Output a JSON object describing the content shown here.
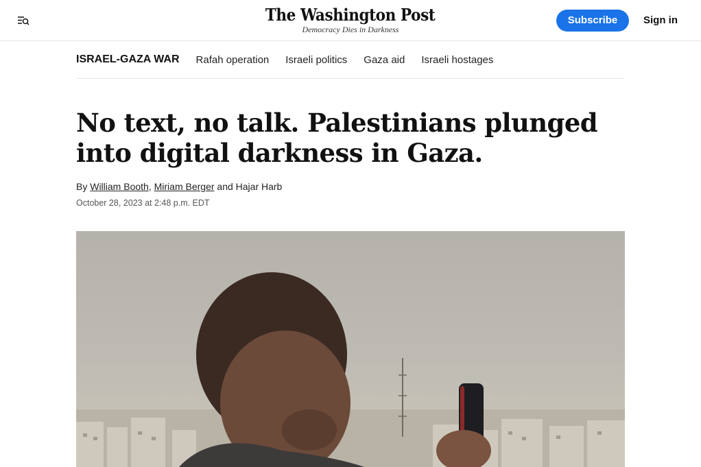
{
  "header": {
    "logo_name": "The Washington Post",
    "logo_tagline": "Democracy Dies in Darkness",
    "subscribe_label": "Subscribe",
    "signin_label": "Sign in"
  },
  "section_nav": {
    "title": "ISRAEL-GAZA WAR",
    "links": [
      "Rafah operation",
      "Israeli politics",
      "Gaza aid",
      "Israeli hostages"
    ]
  },
  "article": {
    "headline": "No text, no talk. Palestinians plunged into digital darkness in Gaza.",
    "byline_prefix": "By",
    "authors": [
      "William Booth",
      "Miriam Berger"
    ],
    "byline_and": "and",
    "byline_last": "Hajar Harb",
    "timestamp": "October 28, 2023 at 2:48 p.m. EDT"
  },
  "colors": {
    "accent": "#1a73e8",
    "text": "#111111"
  }
}
